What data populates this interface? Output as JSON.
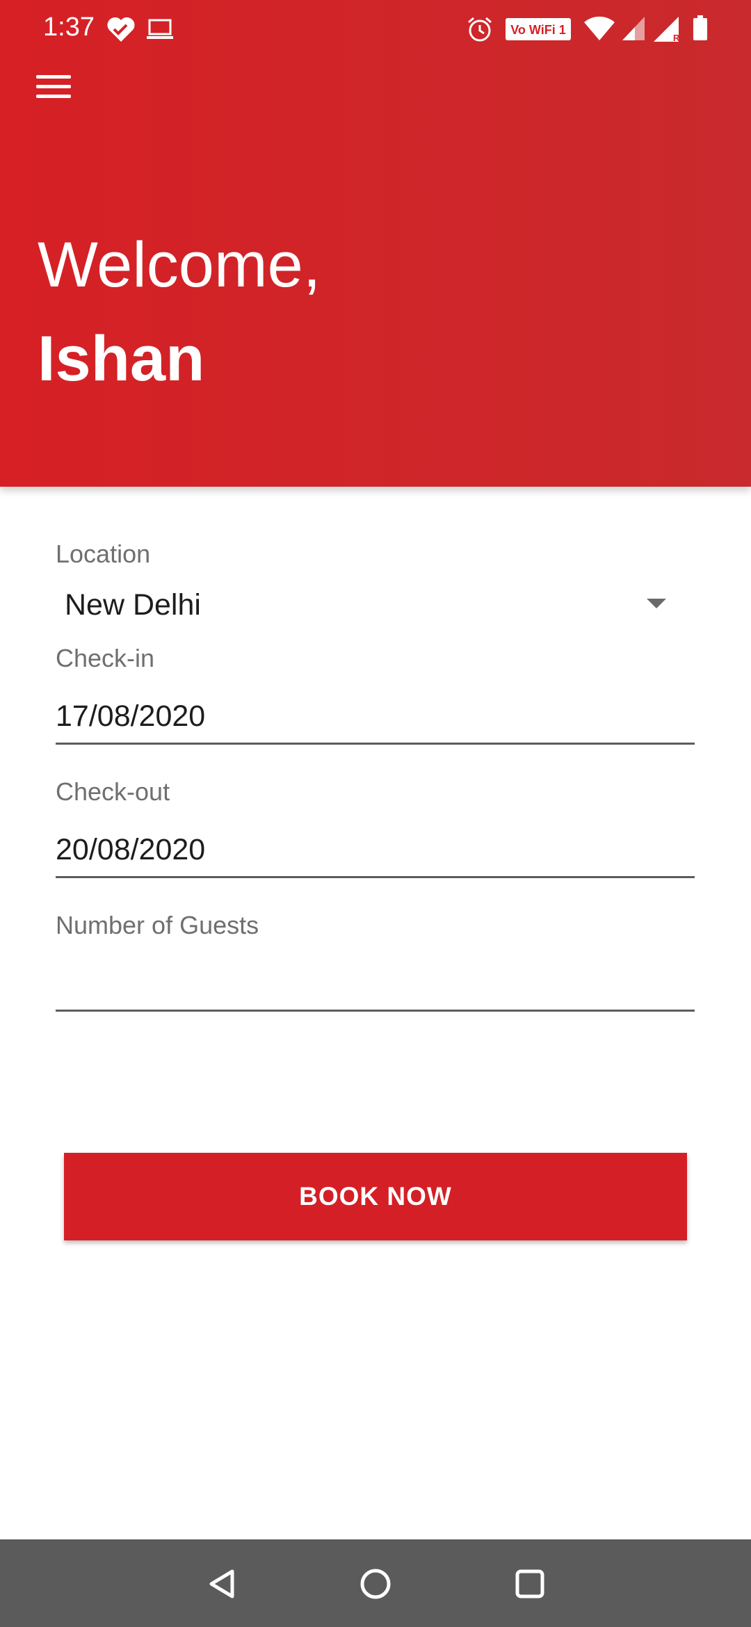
{
  "status_bar": {
    "time": "1:37",
    "icons": [
      "heart-icon",
      "laptop-icon",
      "alarm-icon",
      "vowifi-icon",
      "wifi-icon",
      "signal-icon",
      "signal-roaming-icon",
      "battery-icon"
    ],
    "vowifi_label": "Vo WiFi 1"
  },
  "header": {
    "greeting": "Welcome,",
    "user_name": "Ishan",
    "background": "#d62025"
  },
  "form": {
    "location_label": "Location",
    "location_value": "New Delhi",
    "checkin_label": "Check-in",
    "checkin_value": "17/08/2020",
    "checkout_label": "Check-out",
    "checkout_value": "20/08/2020",
    "guests_label": "Number of Guests",
    "guests_value": ""
  },
  "actions": {
    "book_label": "BOOK NOW",
    "button_color": "#d51f26"
  },
  "nav_bar": {
    "icons": [
      "back-icon",
      "home-icon",
      "recents-icon"
    ]
  }
}
